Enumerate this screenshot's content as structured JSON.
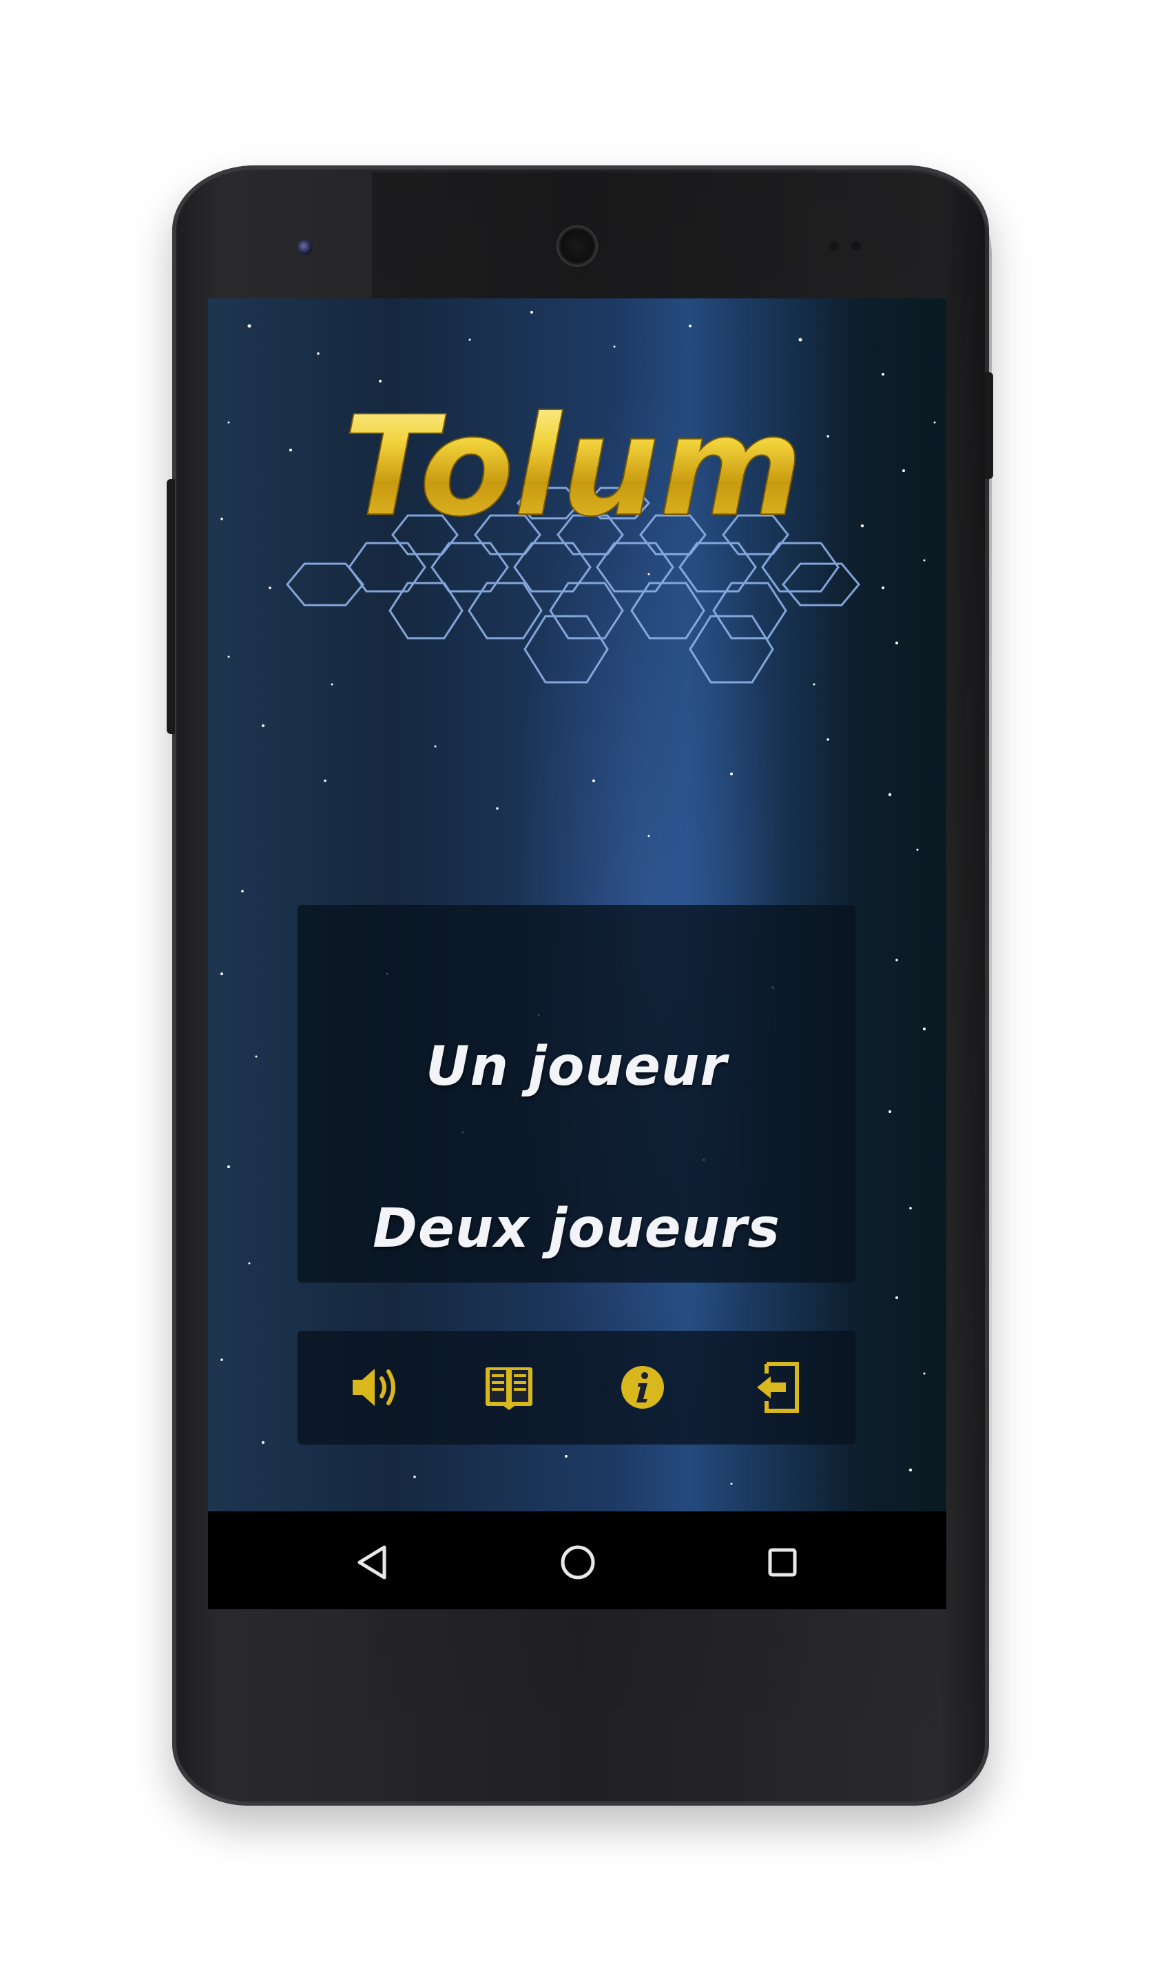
{
  "app": {
    "title": "Tolum",
    "menu": {
      "single_player": "Un joueur",
      "two_players": "Deux joueurs"
    },
    "toolbar": [
      {
        "icon": "speaker-icon"
      },
      {
        "icon": "book-icon"
      },
      {
        "icon": "info-icon"
      },
      {
        "icon": "exit-icon"
      }
    ]
  },
  "navigation_bar": {
    "buttons": [
      {
        "icon": "back-triangle-icon"
      },
      {
        "icon": "home-circle-icon"
      },
      {
        "icon": "recents-square-icon"
      }
    ]
  },
  "colors": {
    "gold": "#d9b81e",
    "hex_grid": "#8fb2e8",
    "menu_text": "#f2f4f8",
    "nav_icon": "#e8e8e8"
  }
}
